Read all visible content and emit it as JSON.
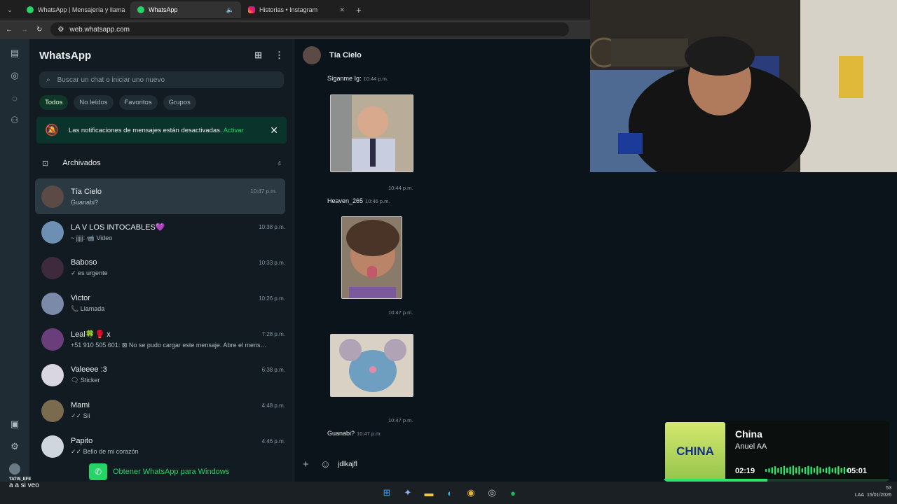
{
  "browser": {
    "tabs": [
      {
        "label": "WhatsApp | Mensajería y llama"
      },
      {
        "label": "WhatsApp"
      },
      {
        "label": "Historias • Instagram"
      }
    ],
    "url": "web.whatsapp.com"
  },
  "sidebar": {
    "title": "WhatsApp",
    "search_placeholder": "Buscar un chat o iniciar uno nuevo",
    "filters": [
      "Todos",
      "No leídos",
      "Favoritos",
      "Grupos"
    ],
    "notice": {
      "text": "Las notificaciones de mensajes están desactivadas.",
      "link": "Activar"
    },
    "archived": {
      "label": "Archivados",
      "count": "4"
    },
    "chats": [
      {
        "name": "Tía Cielo",
        "time": "10:47 p.m.",
        "preview": "Guanabi?",
        "color": "#5b4a46"
      },
      {
        "name": "LA V LOS INTOCABLES💜",
        "time": "10:38 p.m.",
        "preview": "~ jjjjj: 📹 Video",
        "color": "#6c8fb3"
      },
      {
        "name": "Baboso",
        "time": "10:33 p.m.",
        "preview": "✓ es urgente",
        "color": "#3e2a3c"
      },
      {
        "name": "Victor",
        "time": "10:26 p.m.",
        "preview": "📞 Llamada",
        "color": "#7a8aa8"
      },
      {
        "name": "Leal🍀🥊 x",
        "time": "7:28 p.m.",
        "preview": "+51 910 505 601: ⊠ No se pudo cargar este mensaje. Abre el mens…",
        "color": "#6a3e7a"
      },
      {
        "name": "Valeeee :3",
        "time": "6:38 p.m.",
        "preview": "🗨 Sticker",
        "color": "#d9d6e2"
      },
      {
        "name": "Mami",
        "time": "4:48 p.m.",
        "preview": "✓✓ Sii",
        "color": "#7a6a4e"
      },
      {
        "name": "Papito",
        "time": "4:46 p.m.",
        "preview": "✓✓ Bello de mi corazón",
        "color": "#cfd6de"
      }
    ],
    "get_app": "Obtener WhatsApp para Windows"
  },
  "chat": {
    "contact": "Tía Cielo",
    "messages": [
      {
        "text": "Síganme Ig:",
        "time": "10:44 p.m."
      },
      {
        "time_below_img1": "10:44 p.m."
      },
      {
        "text": "Heaven_265",
        "time": "10:46 p.m."
      },
      {
        "time_below_img2": "10:47 p.m."
      },
      {
        "time_below_img3": "10:47 p.m."
      },
      {
        "text": "Guanabi?",
        "time": "10:47 p.m."
      }
    ],
    "compose_value": "jdlkajfl"
  },
  "music": {
    "title": "China",
    "artist": "Anuel AA",
    "cover_text": "CHINA",
    "elapsed": "02:19",
    "duration": "05:01",
    "progress": 0.46
  },
  "taskbar": {
    "user_tag": "TATIS_EFE",
    "caption": "a a si veo",
    "tray_lang": "LAA",
    "tray_num": "53",
    "tray_date": "15/01/2026"
  }
}
